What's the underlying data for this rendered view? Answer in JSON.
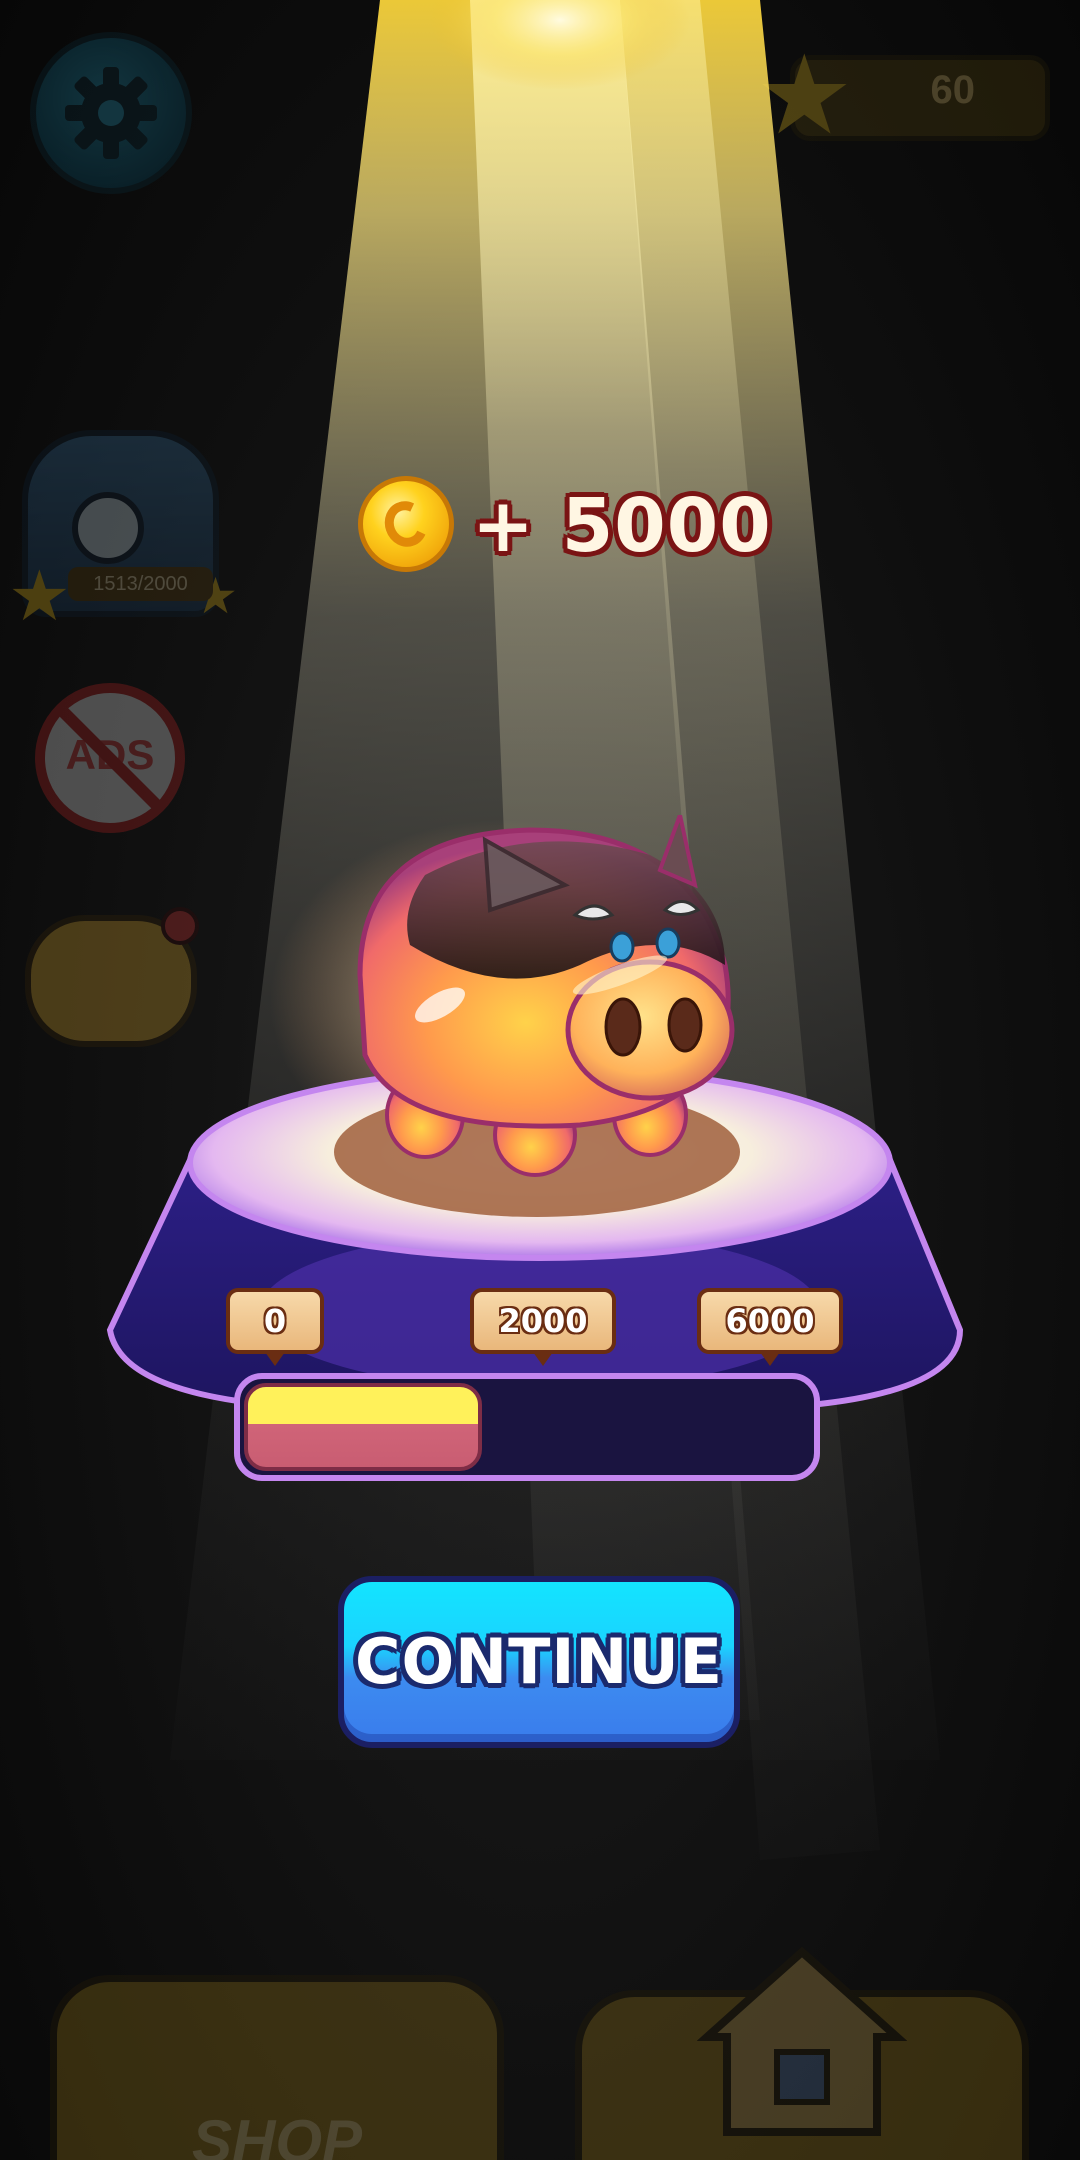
{
  "hud": {
    "star_count": "60",
    "chest_progress": "1513/2000",
    "no_ads_label": "ADS"
  },
  "reward": {
    "amount_text": "+ 5000",
    "icon": "coin-icon"
  },
  "piggy_bank": {
    "milestones": [
      "0",
      "2000",
      "6000"
    ],
    "progress_fraction": 0.42
  },
  "buttons": {
    "continue_label": "CONTINUE"
  },
  "bottom_nav": {
    "shop_label": "SHOP",
    "home_icon": "house-icon"
  },
  "colors": {
    "beam": "#f7d23a",
    "continue_button": "#1ad3ff",
    "progress_fill_top": "#fff15a",
    "progress_fill_bottom": "#d06478",
    "pedestal": "#241a78",
    "pedestal_border": "#c486ef"
  }
}
